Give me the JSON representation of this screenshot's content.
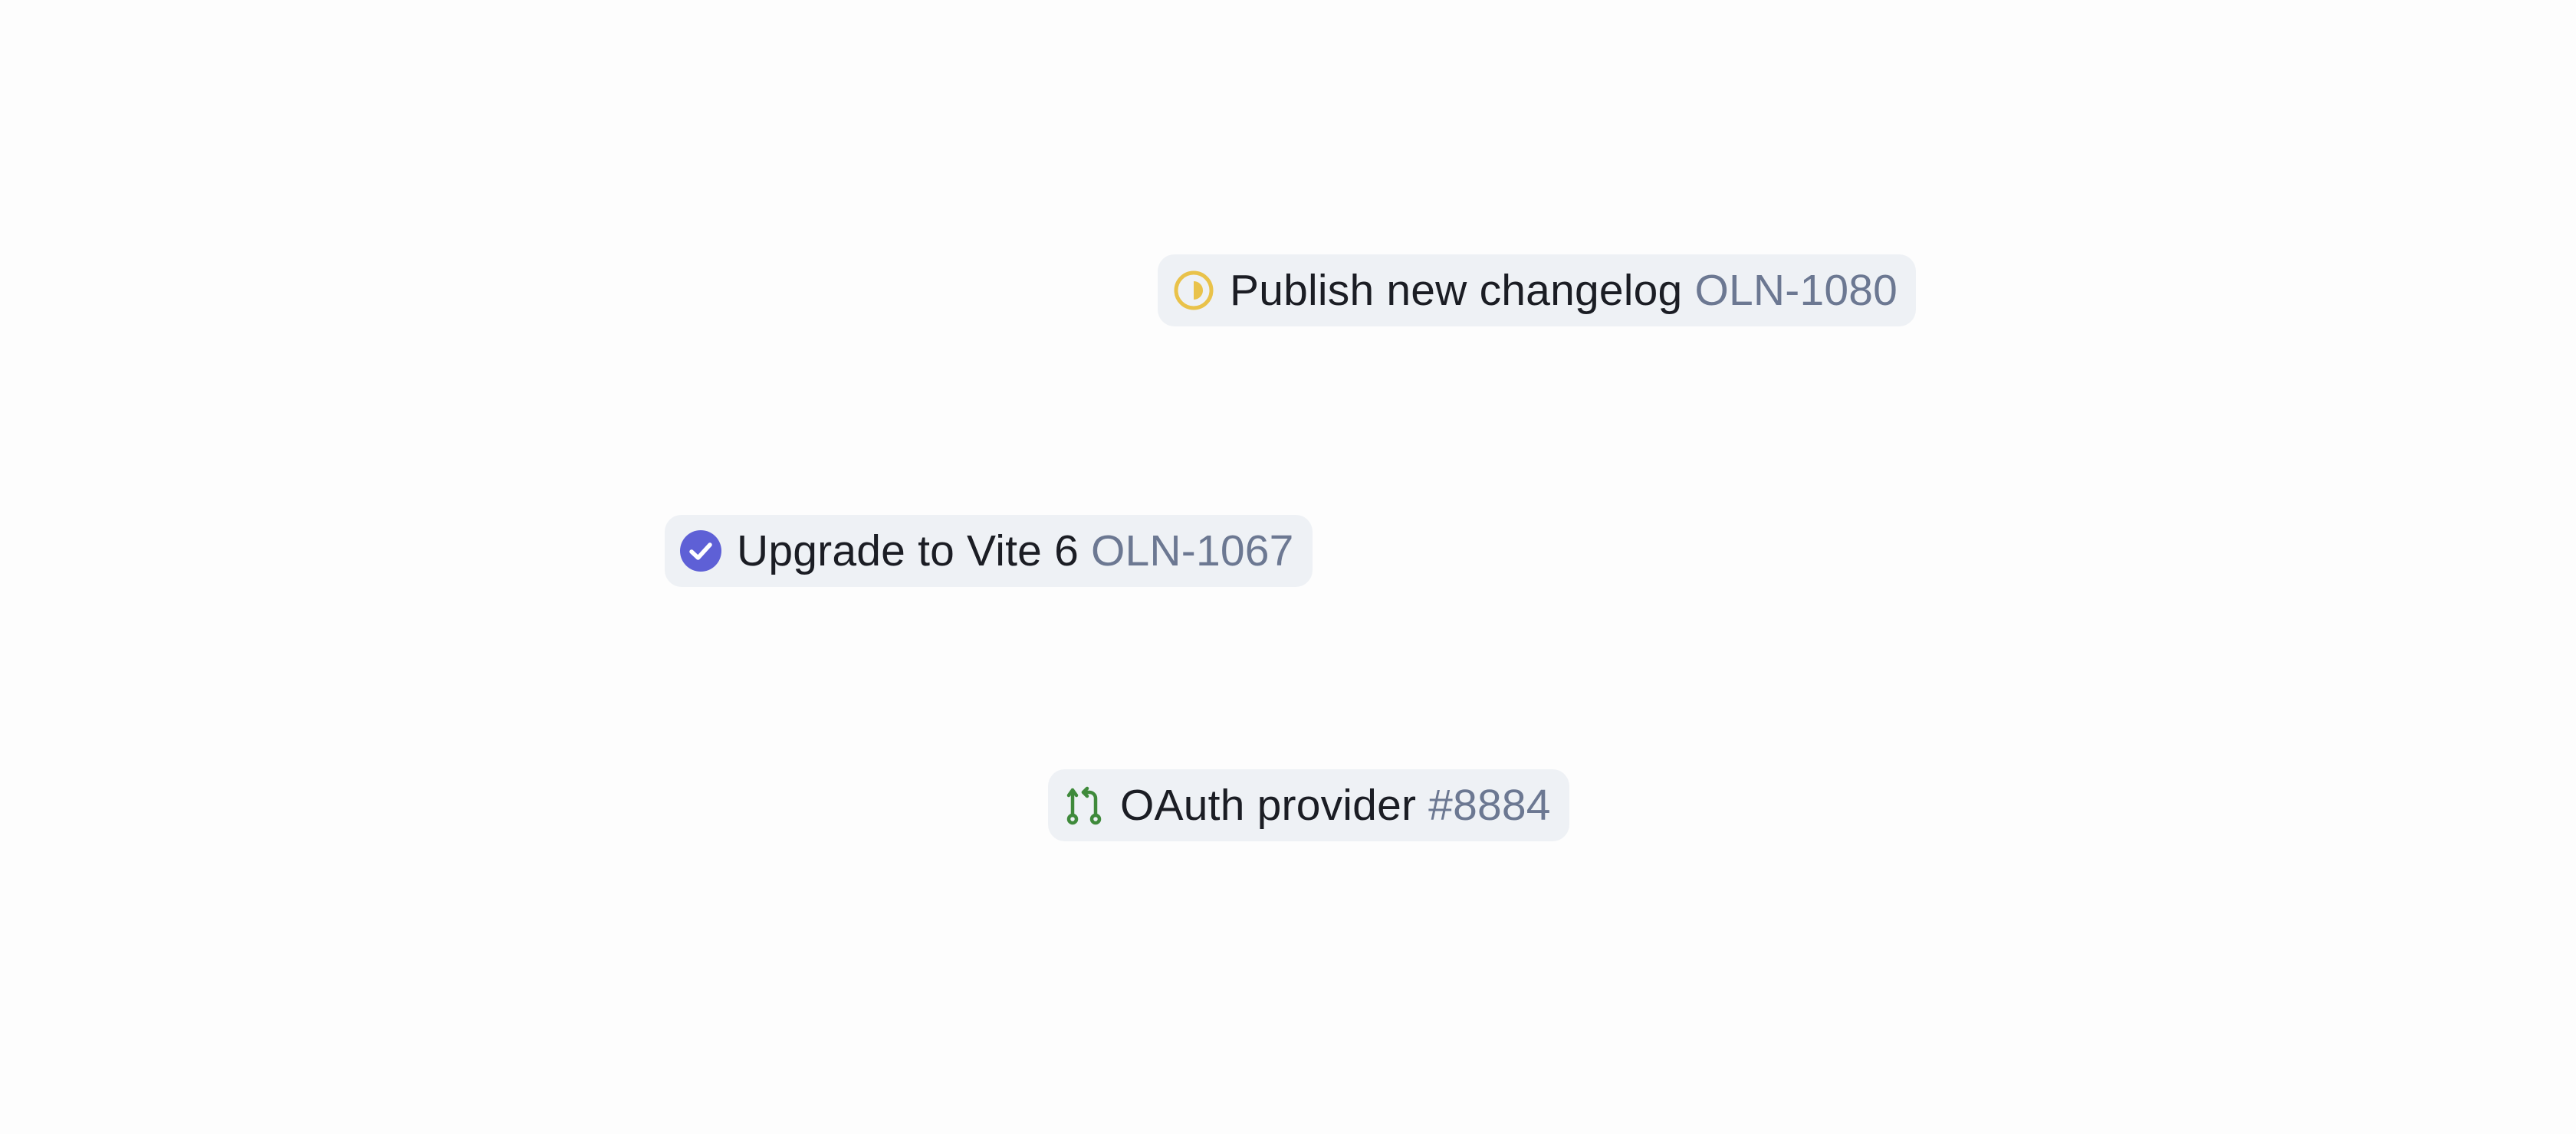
{
  "chips": [
    {
      "title": "Publish new changelog",
      "ref": "OLN-1080",
      "status_icon": "in-progress-icon",
      "status_color": "#e9c24a"
    },
    {
      "title": "Upgrade to Vite 6",
      "ref": "OLN-1067",
      "status_icon": "done-check-icon",
      "status_color": "#5e60d6"
    },
    {
      "title": "OAuth provider",
      "ref": "#8884",
      "status_icon": "pull-request-icon",
      "status_color": "#3f8a3b"
    }
  ],
  "colors": {
    "chip_background": "#eef1f5",
    "title_text": "#1b1d24",
    "ref_text": "#6c7892",
    "page_background": "#fdfdfd"
  }
}
